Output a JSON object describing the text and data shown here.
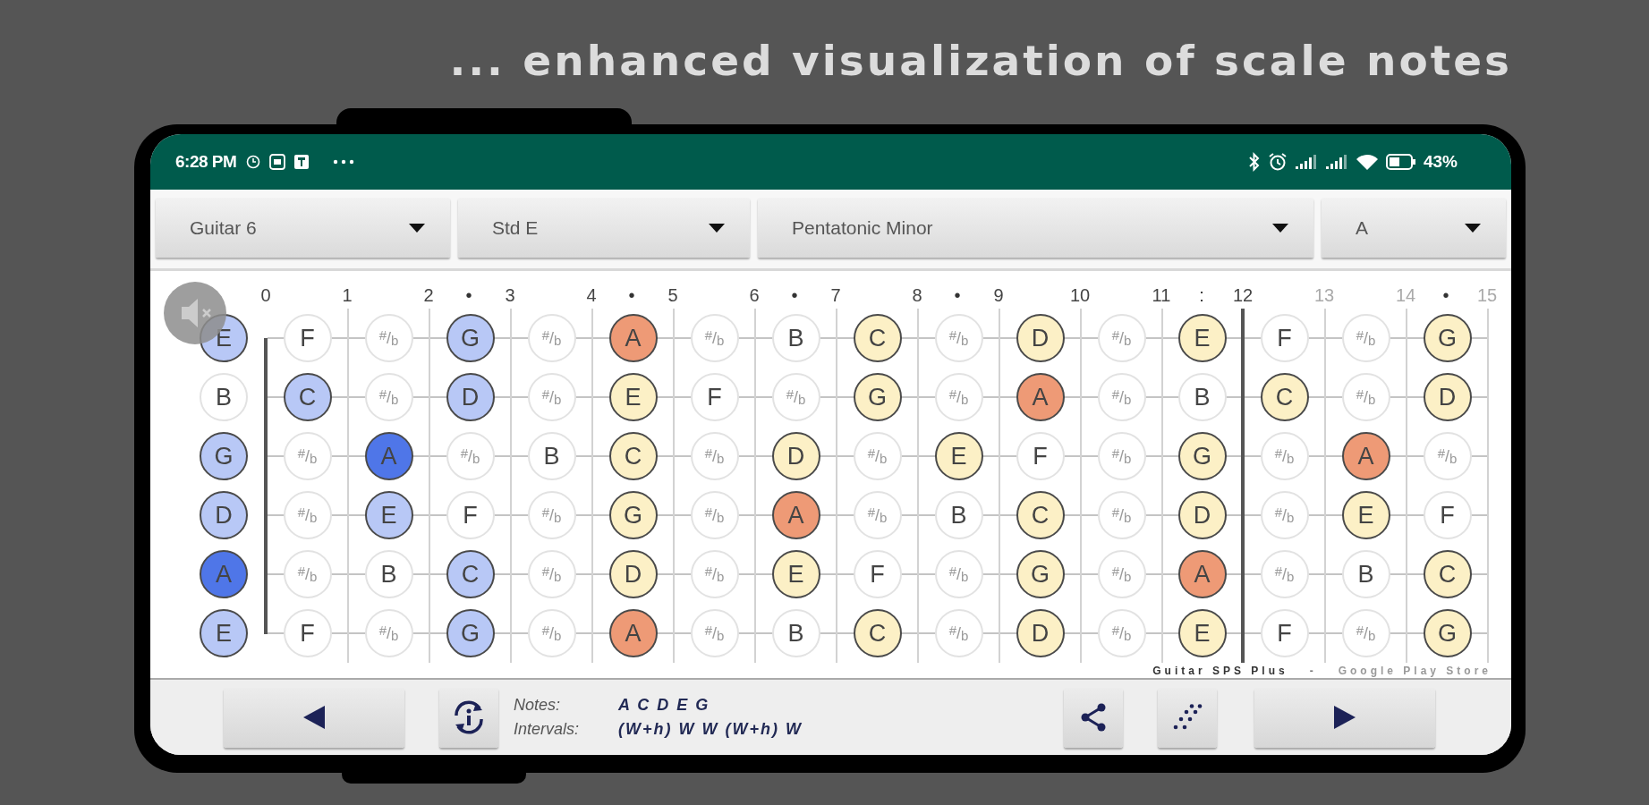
{
  "headline": "... enhanced visualization of scale notes",
  "status_bar": {
    "time": "6:28 PM",
    "battery": "43%"
  },
  "selectors": [
    {
      "value": "Guitar 6"
    },
    {
      "value": "Std E"
    },
    {
      "value": "Pentatonic Minor"
    },
    {
      "value": "A"
    }
  ],
  "fret_labels": [
    {
      "number": "0",
      "faded": false
    },
    {
      "number": "1",
      "faded": false
    },
    {
      "number": "2",
      "faded": false
    },
    {
      "number": "3",
      "marker": "•",
      "faded": false
    },
    {
      "number": "4",
      "faded": false
    },
    {
      "number": "5",
      "marker": "•",
      "faded": false
    },
    {
      "number": "6",
      "faded": false
    },
    {
      "number": "7",
      "marker": "•",
      "faded": false
    },
    {
      "number": "8",
      "faded": false
    },
    {
      "number": "9",
      "marker": "•",
      "faded": false
    },
    {
      "number": "10",
      "faded": false
    },
    {
      "number": "11",
      "faded": false
    },
    {
      "number": "12",
      "marker": ":",
      "faded": false
    },
    {
      "number": "13",
      "faded": true
    },
    {
      "number": "14",
      "faded": true
    },
    {
      "number": "15",
      "marker": "•",
      "faded": true
    }
  ],
  "strings": [
    {
      "notes": [
        {
          "label": "E",
          "kind": "scale",
          "color": "#b8c8f6"
        },
        {
          "label": "F",
          "kind": "natural"
        },
        {
          "label": "$^{#}$/$_{b}$",
          "kind": "accidental"
        },
        {
          "label": "G",
          "kind": "scale",
          "color": "#b8c8f6"
        },
        {
          "label": "$^{#}$/$_{b}$",
          "kind": "accidental"
        },
        {
          "label": "A",
          "kind": "scale",
          "color": "#ee9a76"
        },
        {
          "label": "$^{#}$/$_{b}$",
          "kind": "accidental"
        },
        {
          "label": "B",
          "kind": "natural"
        },
        {
          "label": "C",
          "kind": "scale",
          "color": "#fcf0c6"
        },
        {
          "label": "$^{#}$/$_{b}$",
          "kind": "accidental"
        },
        {
          "label": "D",
          "kind": "scale",
          "color": "#fcf0c6"
        },
        {
          "label": "$^{#}$/$_{b}$",
          "kind": "accidental"
        },
        {
          "label": "E",
          "kind": "scale",
          "color": "#fcf0c6"
        },
        {
          "label": "F",
          "kind": "natural"
        },
        {
          "label": "$^{#}$/$_{b}$",
          "kind": "accidental"
        },
        {
          "label": "G",
          "kind": "scale",
          "color": "#fcf0c6"
        }
      ]
    },
    {
      "notes": [
        {
          "label": "B",
          "kind": "natural"
        },
        {
          "label": "C",
          "kind": "scale",
          "color": "#b8c8f6"
        },
        {
          "label": "$^{#}$/$_{b}$",
          "kind": "accidental"
        },
        {
          "label": "D",
          "kind": "scale",
          "color": "#b8c8f6"
        },
        {
          "label": "$^{#}$/$_{b}$",
          "kind": "accidental"
        },
        {
          "label": "E",
          "kind": "scale",
          "color": "#fcf0c6"
        },
        {
          "label": "F",
          "kind": "natural"
        },
        {
          "label": "$^{#}$/$_{b}$",
          "kind": "accidental"
        },
        {
          "label": "G",
          "kind": "scale",
          "color": "#fcf0c6"
        },
        {
          "label": "$^{#}$/$_{b}$",
          "kind": "accidental"
        },
        {
          "label": "A",
          "kind": "scale",
          "color": "#ee9a76"
        },
        {
          "label": "$^{#}$/$_{b}$",
          "kind": "accidental"
        },
        {
          "label": "B",
          "kind": "natural"
        },
        {
          "label": "C",
          "kind": "scale",
          "color": "#fcf0c6"
        },
        {
          "label": "$^{#}$/$_{b}$",
          "kind": "accidental"
        },
        {
          "label": "D",
          "kind": "scale",
          "color": "#fcf0c6"
        }
      ]
    },
    {
      "notes": [
        {
          "label": "G",
          "kind": "scale",
          "color": "#b8c8f6"
        },
        {
          "label": "$^{#}$/$_{b}$",
          "kind": "accidental"
        },
        {
          "label": "A",
          "kind": "scale",
          "color": "#4f76e8"
        },
        {
          "label": "$^{#}$/$_{b}$",
          "kind": "accidental"
        },
        {
          "label": "B",
          "kind": "natural"
        },
        {
          "label": "C",
          "kind": "scale",
          "color": "#fcf0c6"
        },
        {
          "label": "$^{#}$/$_{b}$",
          "kind": "accidental"
        },
        {
          "label": "D",
          "kind": "scale",
          "color": "#fcf0c6"
        },
        {
          "label": "$^{#}$/$_{b}$",
          "kind": "accidental"
        },
        {
          "label": "E",
          "kind": "scale",
          "color": "#fcf0c6"
        },
        {
          "label": "F",
          "kind": "natural"
        },
        {
          "label": "$^{#}$/$_{b}$",
          "kind": "accidental"
        },
        {
          "label": "G",
          "kind": "scale",
          "color": "#fcf0c6"
        },
        {
          "label": "$^{#}$/$_{b}$",
          "kind": "accidental"
        },
        {
          "label": "A",
          "kind": "scale",
          "color": "#ee9a76"
        },
        {
          "label": "$^{#}$/$_{b}$",
          "kind": "accidental"
        }
      ]
    },
    {
      "notes": [
        {
          "label": "D",
          "kind": "scale",
          "color": "#b8c8f6"
        },
        {
          "label": "$^{#}$/$_{b}$",
          "kind": "accidental"
        },
        {
          "label": "E",
          "kind": "scale",
          "color": "#b8c8f6"
        },
        {
          "label": "F",
          "kind": "natural"
        },
        {
          "label": "$^{#}$/$_{b}$",
          "kind": "accidental"
        },
        {
          "label": "G",
          "kind": "scale",
          "color": "#fcf0c6"
        },
        {
          "label": "$^{#}$/$_{b}$",
          "kind": "accidental"
        },
        {
          "label": "A",
          "kind": "scale",
          "color": "#ee9a76"
        },
        {
          "label": "$^{#}$/$_{b}$",
          "kind": "accidental"
        },
        {
          "label": "B",
          "kind": "natural"
        },
        {
          "label": "C",
          "kind": "scale",
          "color": "#fcf0c6"
        },
        {
          "label": "$^{#}$/$_{b}$",
          "kind": "accidental"
        },
        {
          "label": "D",
          "kind": "scale",
          "color": "#fcf0c6"
        },
        {
          "label": "$^{#}$/$_{b}$",
          "kind": "accidental"
        },
        {
          "label": "E",
          "kind": "scale",
          "color": "#fcf0c6"
        },
        {
          "label": "F",
          "kind": "natural"
        }
      ]
    },
    {
      "notes": [
        {
          "label": "A",
          "kind": "scale",
          "color": "#4f76e8"
        },
        {
          "label": "$^{#}$/$_{b}$",
          "kind": "accidental"
        },
        {
          "label": "B",
          "kind": "natural"
        },
        {
          "label": "C",
          "kind": "scale",
          "color": "#b8c8f6"
        },
        {
          "label": "$^{#}$/$_{b}$",
          "kind": "accidental"
        },
        {
          "label": "D",
          "kind": "scale",
          "color": "#fcf0c6"
        },
        {
          "label": "$^{#}$/$_{b}$",
          "kind": "accidental"
        },
        {
          "label": "E",
          "kind": "scale",
          "color": "#fcf0c6"
        },
        {
          "label": "F",
          "kind": "natural"
        },
        {
          "label": "$^{#}$/$_{b}$",
          "kind": "accidental"
        },
        {
          "label": "G",
          "kind": "scale",
          "color": "#fcf0c6"
        },
        {
          "label": "$^{#}$/$_{b}$",
          "kind": "accidental"
        },
        {
          "label": "A",
          "kind": "scale",
          "color": "#ee9a76"
        },
        {
          "label": "$^{#}$/$_{b}$",
          "kind": "accidental"
        },
        {
          "label": "B",
          "kind": "natural"
        },
        {
          "label": "C",
          "kind": "scale",
          "color": "#fcf0c6"
        }
      ]
    },
    {
      "notes": [
        {
          "label": "E",
          "kind": "scale",
          "color": "#b8c8f6"
        },
        {
          "label": "F",
          "kind": "natural"
        },
        {
          "label": "$^{#}$/$_{b}$",
          "kind": "accidental"
        },
        {
          "label": "G",
          "kind": "scale",
          "color": "#b8c8f6"
        },
        {
          "label": "$^{#}$/$_{b}$",
          "kind": "accidental"
        },
        {
          "label": "A",
          "kind": "scale",
          "color": "#ee9a76"
        },
        {
          "label": "$^{#}$/$_{b}$",
          "kind": "accidental"
        },
        {
          "label": "B",
          "kind": "natural"
        },
        {
          "label": "C",
          "kind": "scale",
          "color": "#fcf0c6"
        },
        {
          "label": "$^{#}$/$_{b}$",
          "kind": "accidental"
        },
        {
          "label": "D",
          "kind": "scale",
          "color": "#fcf0c6"
        },
        {
          "label": "$^{#}$/$_{b}$",
          "kind": "accidental"
        },
        {
          "label": "E",
          "kind": "scale",
          "color": "#fcf0c6"
        },
        {
          "label": "F",
          "kind": "natural"
        },
        {
          "label": "$^{#}$/$_{b}$",
          "kind": "accidental"
        },
        {
          "label": "G",
          "kind": "scale",
          "color": "#fcf0c6"
        }
      ]
    }
  ],
  "credit": {
    "app": "Guitar SPS Plus",
    "separator": "-",
    "store": "Google Play Store"
  },
  "scale_info": {
    "notes_label": "Notes:",
    "notes": "A C D E G",
    "intervals_label": "Intervals:",
    "intervals": "(W+h) W W (W+h) W"
  }
}
